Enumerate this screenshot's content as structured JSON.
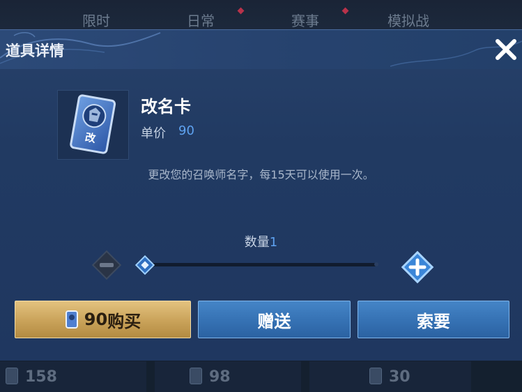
{
  "background_tabs": [
    "限时",
    "日常",
    "赛事",
    "模拟战"
  ],
  "background_prices": [
    "158",
    "98",
    "30"
  ],
  "dialog": {
    "title": "道具详情",
    "close_icon": "close-x-icon"
  },
  "item": {
    "name": "改名卡",
    "icon": "rename-card-icon",
    "card_glyph": "改",
    "price_label": "单价",
    "price": "90",
    "description": "更改您的召唤师名字，每15天可以使用一次。"
  },
  "quantity": {
    "label": "数量",
    "value": "1",
    "slider_fraction": 0
  },
  "buttons": {
    "buy_price": "90",
    "buy_label": "购买",
    "gift_label": "赠送",
    "ask_label": "索要"
  },
  "colors": {
    "accent_blue": "#5ea2f0",
    "gold": "#d2ad63",
    "panel": "#223b63"
  }
}
